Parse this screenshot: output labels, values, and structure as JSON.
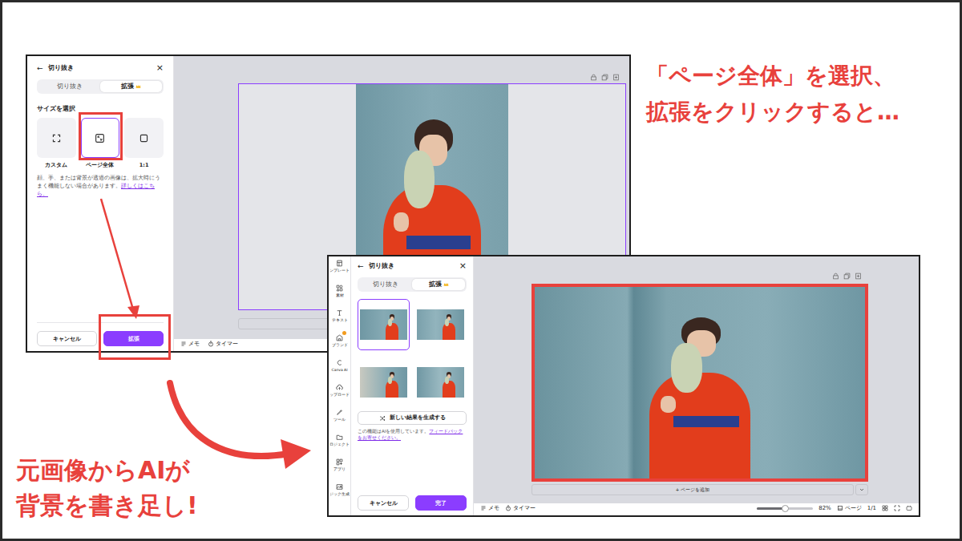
{
  "annotations": {
    "top": [
      "「ページ全体」を選択、",
      "拡張をクリックすると…"
    ],
    "bottom": [
      "元画像からAIが",
      "背景を書き足し!"
    ]
  },
  "step1": {
    "panel": {
      "back": "←",
      "title": "切り抜き",
      "close": "×",
      "tabs": [
        {
          "label": "切り抜き",
          "selected": false,
          "premium": false
        },
        {
          "label": "拡張",
          "selected": true,
          "premium": true
        }
      ],
      "section": "サイズを選択",
      "options": [
        {
          "label": "カスタム",
          "kind": "custom",
          "selected": false
        },
        {
          "label": "ページ全体",
          "kind": "fill",
          "selected": true
        },
        {
          "label": "1:1",
          "kind": "square",
          "selected": false
        }
      ],
      "note": "顔、手、または背景が透過の画像は、拡大時にうまく機能しない場合があります。",
      "link": "詳しくはこちら。",
      "buttons": [
        {
          "label": "キャンセル",
          "primary": false
        },
        {
          "label": "拡張",
          "primary": true
        }
      ]
    },
    "toolbar": [
      "メモ",
      "タイマー"
    ]
  },
  "step2": {
    "rail": [
      {
        "label": "ンプレート",
        "kind": "template",
        "badge": false
      },
      {
        "label": "素材",
        "kind": "elements",
        "badge": false
      },
      {
        "label": "テキスト",
        "kind": "text",
        "badge": false
      },
      {
        "label": "ブランド",
        "kind": "brand",
        "badge": true
      },
      {
        "label": "Canva AI",
        "kind": "ai",
        "badge": false
      },
      {
        "label": "ップロード",
        "kind": "upload",
        "badge": false
      },
      {
        "label": "ツール",
        "kind": "tools",
        "badge": false
      },
      {
        "label": "ロジェクト",
        "kind": "projects",
        "badge": false
      },
      {
        "label": "アプリ",
        "kind": "apps",
        "badge": false
      },
      {
        "label": "ジック生成",
        "kind": "magic",
        "badge": false
      }
    ],
    "panel": {
      "back": "←",
      "title": "切り抜き",
      "close": "×",
      "tabs": [
        {
          "label": "切り抜き",
          "selected": false,
          "premium": false
        },
        {
          "label": "拡張",
          "selected": true,
          "premium": true
        }
      ],
      "thumbnails": [
        {
          "selected": true
        },
        {
          "selected": false
        },
        {
          "selected": false
        },
        {
          "selected": false
        }
      ],
      "generate": "新しい結果を生成する",
      "note": "この機能はAIを使用しています。",
      "link": "フィードバックをお寄せください。",
      "buttons": [
        {
          "label": "キャンセル",
          "primary": false
        },
        {
          "label": "完了",
          "primary": true
        }
      ]
    },
    "add_page": "+ ページを追加",
    "toolbar": [
      "メモ",
      "タイマー"
    ],
    "zoom": {
      "level": 0.5,
      "reading": "82%"
    },
    "page_label": "ページ",
    "page_count": "1/1"
  }
}
